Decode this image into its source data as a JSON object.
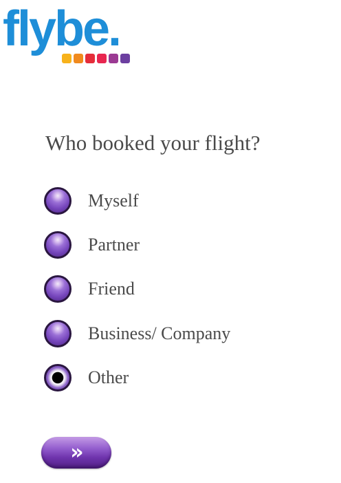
{
  "brand": {
    "logo_text": "flybe",
    "logo_dot": ".",
    "dot_colors": [
      "#f7b21b",
      "#f08a1e",
      "#e52d3a",
      "#e8264f",
      "#9b3a93",
      "#6c3fa0"
    ]
  },
  "survey": {
    "question": "Who booked your flight?",
    "options": [
      {
        "label": "Myself",
        "selected": false
      },
      {
        "label": "Partner",
        "selected": false
      },
      {
        "label": "Friend",
        "selected": false
      },
      {
        "label": "Business/ Company",
        "selected": true
      },
      {
        "label": "Other",
        "selected": false
      }
    ],
    "selected_option": "Other",
    "next_button_label": "»"
  },
  "colors": {
    "text": "#4a4a4a",
    "logo_blue": "#1e8ed8",
    "accent_purple": "#7747bd"
  }
}
